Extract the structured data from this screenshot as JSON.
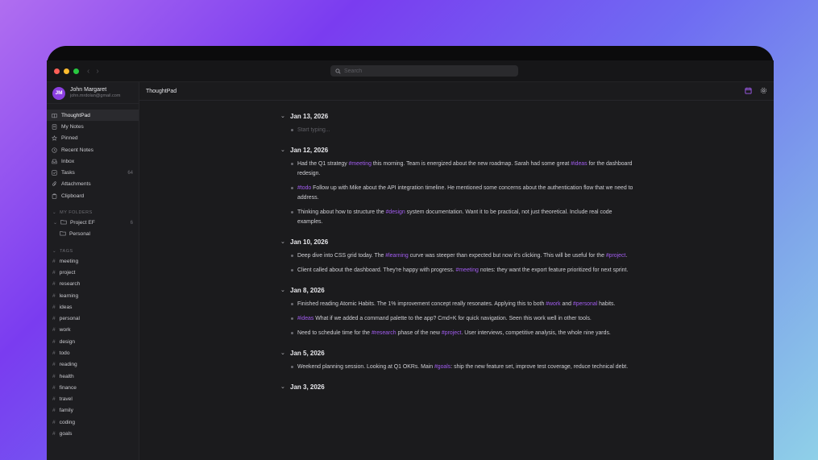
{
  "app": {
    "name": "ThoughtPad",
    "search_placeholder": "Search"
  },
  "user": {
    "initials": "JM",
    "name": "John Margaret",
    "email": "john.mrdolan@gmail.com"
  },
  "nav": [
    {
      "label": "ThoughtPad",
      "icon": "book-icon",
      "active": true
    },
    {
      "label": "My Notes",
      "icon": "notes-icon"
    },
    {
      "label": "Pinned",
      "icon": "star-icon"
    },
    {
      "label": "Recent Notes",
      "icon": "clock-icon"
    },
    {
      "label": "Inbox",
      "icon": "inbox-icon"
    },
    {
      "label": "Tasks",
      "icon": "checkbox-icon",
      "count": "64"
    },
    {
      "label": "Attachments",
      "icon": "paperclip-icon"
    },
    {
      "label": "Clipboard",
      "icon": "clipboard-icon"
    }
  ],
  "folders": {
    "section_label": "MY FOLDERS",
    "items": [
      {
        "label": "Project EF",
        "count": "6"
      },
      {
        "label": "Personal"
      }
    ]
  },
  "tags": {
    "section_label": "TAGS",
    "items": [
      "meeting",
      "project",
      "research",
      "learning",
      "ideas",
      "personal",
      "work",
      "design",
      "todo",
      "reading",
      "health",
      "finance",
      "travel",
      "family",
      "coding",
      "goals"
    ]
  },
  "main": {
    "title": "ThoughtPad",
    "header_icons": [
      "calendar-icon",
      "settings-icon"
    ]
  },
  "days": [
    {
      "date": "Jan 13, 2026",
      "entries": [
        {
          "placeholder": true,
          "parts": [
            {
              "t": "Start typing..."
            }
          ]
        }
      ]
    },
    {
      "date": "Jan 12, 2026",
      "entries": [
        {
          "parts": [
            {
              "t": "Had the Q1 strategy "
            },
            {
              "t": "#meeting",
              "tag": true
            },
            {
              "t": " this morning. Team is energized about the new roadmap. Sarah had some great "
            },
            {
              "t": "#ideas",
              "tag": true
            },
            {
              "t": " for the dashboard redesign."
            }
          ]
        },
        {
          "parts": [
            {
              "t": "#todo",
              "tag": true
            },
            {
              "t": " Follow up with Mike about the API integration timeline. He mentioned some concerns about the authentication flow that we need to address."
            }
          ]
        },
        {
          "parts": [
            {
              "t": "Thinking about how to structure the "
            },
            {
              "t": "#design",
              "tag": true
            },
            {
              "t": " system documentation. Want it to be practical, not just theoretical. Include real code examples."
            }
          ]
        }
      ]
    },
    {
      "date": "Jan 10, 2026",
      "entries": [
        {
          "parts": [
            {
              "t": "Deep dive into CSS grid today. The "
            },
            {
              "t": "#learning",
              "tag": true
            },
            {
              "t": " curve was steeper than expected but now it's clicking. This will be useful for the "
            },
            {
              "t": "#project",
              "tag": true
            },
            {
              "t": "."
            }
          ]
        },
        {
          "parts": [
            {
              "t": "Client called about the dashboard. They're happy with progress. "
            },
            {
              "t": "#meeting",
              "tag": true
            },
            {
              "t": " notes: they want the export feature prioritized for next sprint."
            }
          ]
        }
      ]
    },
    {
      "date": "Jan 8, 2026",
      "entries": [
        {
          "parts": [
            {
              "t": "Finished reading Atomic Habits. The 1% improvement concept really resonates. Applying this to both "
            },
            {
              "t": "#work",
              "tag": true
            },
            {
              "t": " and "
            },
            {
              "t": "#personal",
              "tag": true
            },
            {
              "t": " habits."
            }
          ]
        },
        {
          "parts": [
            {
              "t": "#ideas",
              "tag": true
            },
            {
              "t": " What if we added a command palette to the app? Cmd+K for quick navigation. Seen this work well in other tools."
            }
          ]
        },
        {
          "parts": [
            {
              "t": "Need to schedule time for the "
            },
            {
              "t": "#research",
              "tag": true
            },
            {
              "t": " phase of the new "
            },
            {
              "t": "#project",
              "tag": true
            },
            {
              "t": ". User interviews, competitive analysis, the whole nine yards."
            }
          ]
        }
      ]
    },
    {
      "date": "Jan 5, 2026",
      "entries": [
        {
          "parts": [
            {
              "t": "Weekend planning session. Looking at Q1 OKRs. Main "
            },
            {
              "t": "#goals",
              "tag": true
            },
            {
              "t": ": ship the new feature set, improve test coverage, reduce technical debt."
            }
          ]
        }
      ]
    },
    {
      "date": "Jan 3, 2026",
      "entries": []
    }
  ],
  "colors": {
    "accent": "#a25cf0",
    "avatar": "#8b3fe0",
    "traffic_red": "#ff5f57",
    "traffic_yellow": "#febc2e",
    "traffic_green": "#28c840"
  }
}
